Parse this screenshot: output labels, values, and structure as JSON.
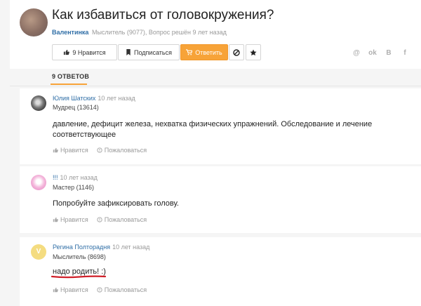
{
  "question": {
    "title": "Как избавиться от головокружения?",
    "author": "Валентинка",
    "meta": "Мыслитель (9077), Вопрос решён 9 лет назад",
    "like_label": "9 Нравится",
    "subscribe_label": "Подписаться",
    "answer_label": "Ответить"
  },
  "tabs": {
    "answers_label": "9 ОТВЕТОВ"
  },
  "answers": [
    {
      "author": "Юлия Шатских",
      "time": "10 лет назад",
      "rank": "Мудрец (13614)",
      "text": "давление, дефицит железа, нехватка физических упражнений. Обследование и лечение соответствующее",
      "like": "Нравится",
      "report": "Пожаловаться"
    },
    {
      "author": "!!!",
      "time": "10 лет назад",
      "rank": "Мастер (1146)",
      "text": "Попробуйте зафиксировать голову.",
      "like": "Нравится",
      "report": "Пожаловаться"
    },
    {
      "author": "Регина Полторадня",
      "time": "10 лет назад",
      "rank": "Мыслитель (8698)",
      "text": "надо родить! :)",
      "like": "Нравится",
      "report": "Пожаловаться",
      "avatar_letter": "V"
    }
  ],
  "colors": {
    "accent": "#f7a338",
    "link": "#2f6ea6",
    "highlight": "#d0202a"
  },
  "icons": [
    "thumbs-up-icon",
    "bookmark-icon",
    "cart-icon",
    "ban-icon",
    "star-icon",
    "odnoklassniki-icon",
    "vk-icon",
    "facebook-icon",
    "mail-icon"
  ]
}
